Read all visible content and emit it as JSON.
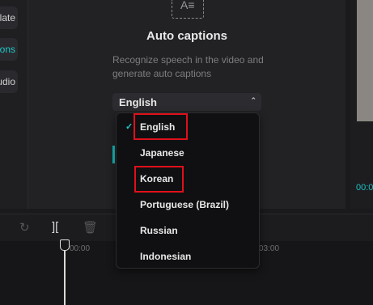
{
  "left_rail": {
    "items": [
      {
        "label": "Translate",
        "active": false
      },
      {
        "label": "Auto captions",
        "active": true
      },
      {
        "label": "Audio..."
      }
    ]
  },
  "panel": {
    "icon_glyph": "A≡",
    "title": "Auto captions",
    "description": "Recognize speech in the video and generate auto captions",
    "select": {
      "value": "English",
      "chevron": "⌃"
    }
  },
  "preview": {
    "time": "00:00"
  },
  "toolbar": {
    "undo": "↺",
    "redo": "↻",
    "split": "][",
    "delete": "🗑"
  },
  "timeline": {
    "ruler": [
      "00:00",
      "03:00"
    ]
  },
  "dropdown": {
    "options": [
      {
        "label": "English",
        "selected": true,
        "check": "✓",
        "highlighted": true
      },
      {
        "label": "Japanese",
        "selected": false,
        "highlighted": false
      },
      {
        "label": "Korean",
        "selected": false,
        "highlighted": true
      },
      {
        "label": "Portuguese (Brazil)",
        "selected": false,
        "highlighted": false
      },
      {
        "label": "Russian",
        "selected": false,
        "highlighted": false
      },
      {
        "label": "Indonesian",
        "selected": false,
        "highlighted": false
      }
    ]
  },
  "colors": {
    "accent": "#20c5c5",
    "highlight": "#e0101a"
  }
}
